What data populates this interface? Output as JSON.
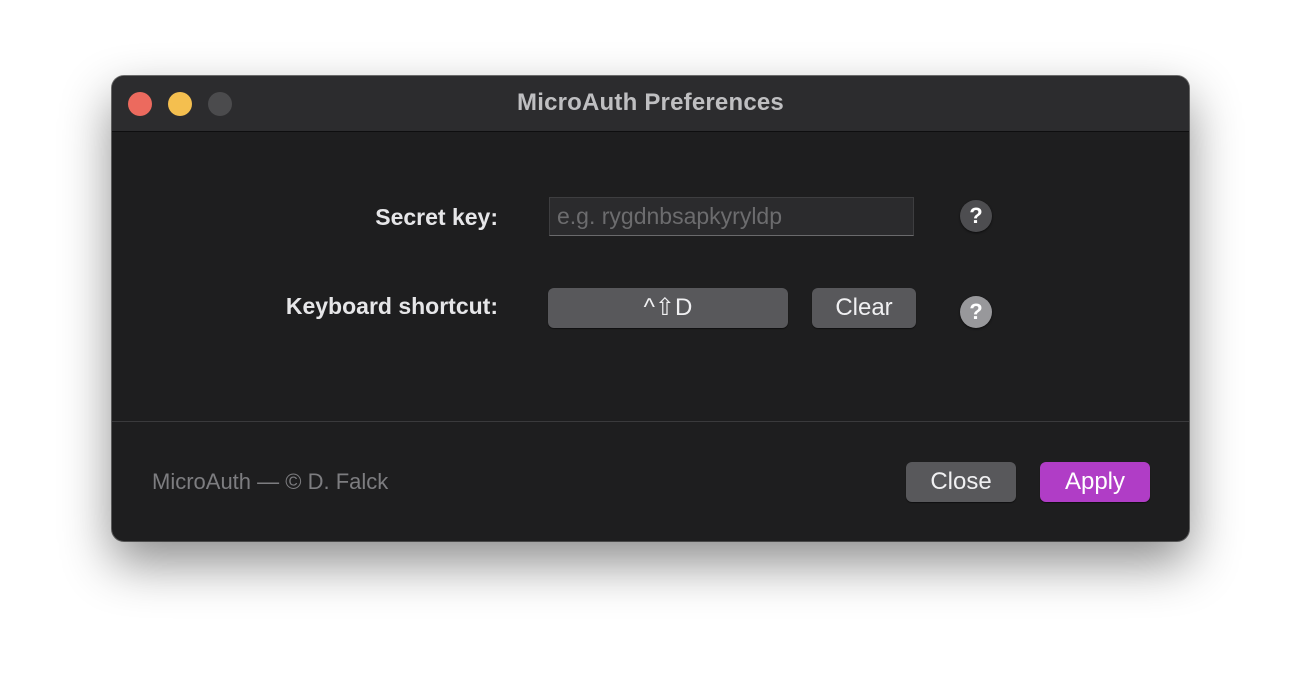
{
  "window": {
    "title": "MicroAuth Preferences"
  },
  "secret": {
    "label": "Secret key:",
    "value": "",
    "placeholder": "e.g. rygdnbsapkyryldp",
    "help": "?"
  },
  "shortcut": {
    "label": "Keyboard shortcut:",
    "value": "^⇧D",
    "clear_label": "Clear",
    "help": "?"
  },
  "footer": {
    "credit": "MicroAuth — © D. Falck",
    "close_label": "Close",
    "apply_label": "Apply"
  },
  "colors": {
    "accent": "#b03dc6",
    "window_bg": "#1e1e1f",
    "titlebar_bg": "#2c2c2e"
  }
}
